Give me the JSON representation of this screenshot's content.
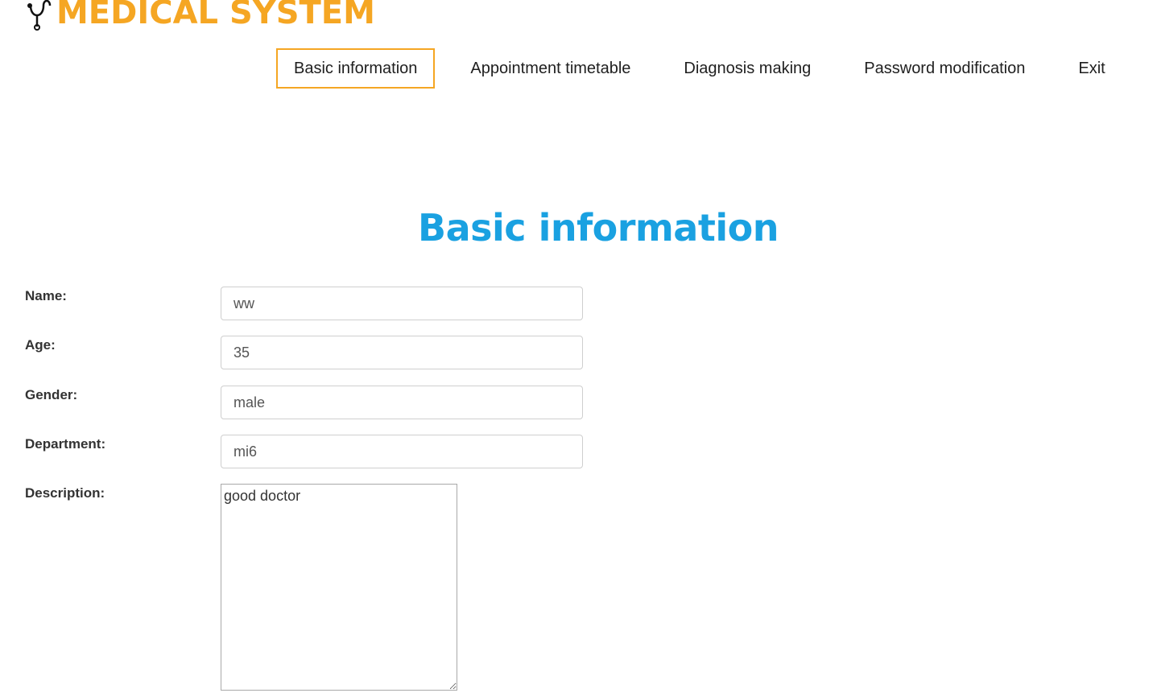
{
  "brand": {
    "title": "MEDICAL SYSTEM",
    "icon": "stethoscope-icon",
    "color": "#f5a623"
  },
  "nav": {
    "items": [
      {
        "label": "Basic information",
        "active": true
      },
      {
        "label": "Appointment timetable",
        "active": false
      },
      {
        "label": "Diagnosis making",
        "active": false
      },
      {
        "label": "Password modification",
        "active": false
      },
      {
        "label": "Exit",
        "active": false
      }
    ],
    "active_border_color": "#f5a623"
  },
  "main": {
    "title": "Basic information",
    "title_color": "#1aa1e1"
  },
  "form": {
    "name": {
      "label": "Name:",
      "value": "ww"
    },
    "age": {
      "label": "Age:",
      "value": "35"
    },
    "gender": {
      "label": "Gender:",
      "value": "male"
    },
    "department": {
      "label": "Department:",
      "value": "mi6"
    },
    "description": {
      "label": "Description:",
      "value": "good doctor"
    }
  }
}
